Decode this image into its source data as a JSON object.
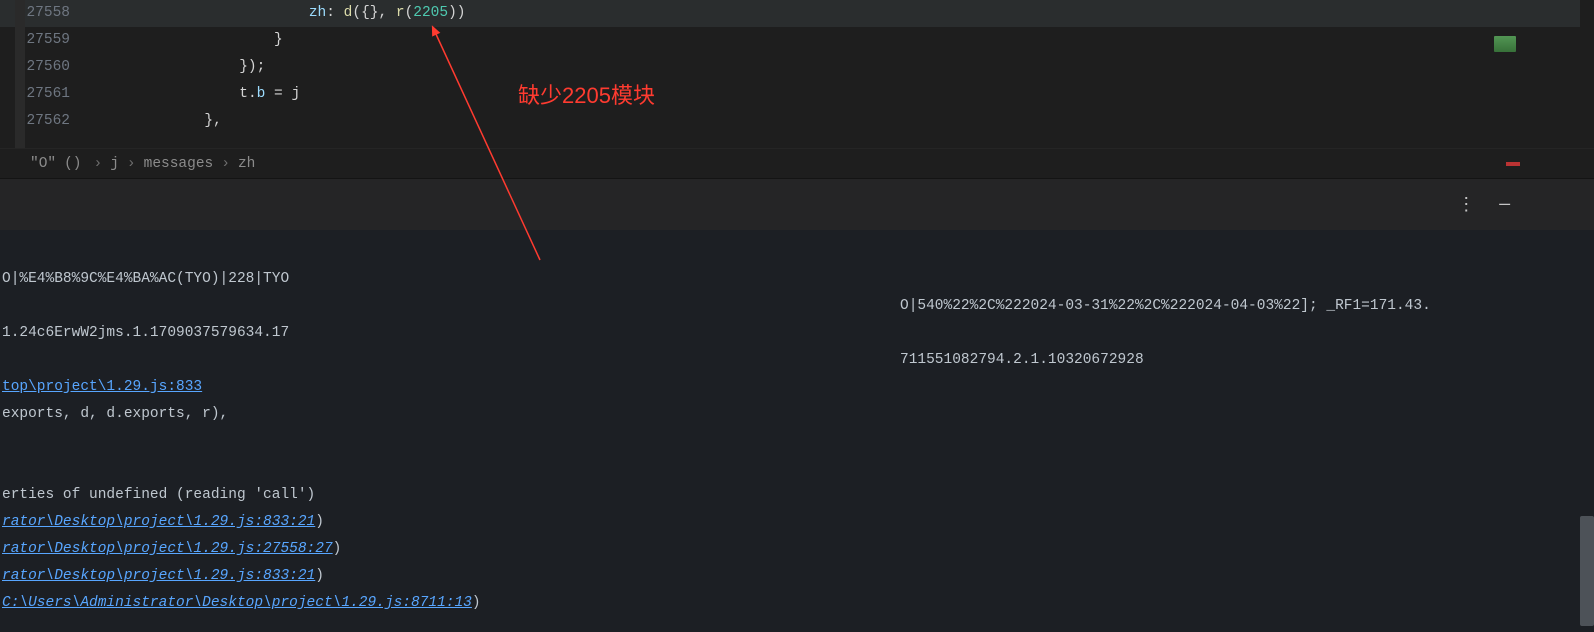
{
  "editor": {
    "lines": [
      {
        "num": "27558",
        "hl": true
      },
      {
        "num": "27559",
        "hl": false
      },
      {
        "num": "27560",
        "hl": false
      },
      {
        "num": "27561",
        "hl": false
      },
      {
        "num": "27562",
        "hl": false
      }
    ],
    "code": {
      "l0_prop": "zh",
      "l0_fn_d": "d",
      "l0_empty": "{}",
      "l0_fn_r": "r",
      "l0_num": "2205",
      "l1": "                    }",
      "l2": "                });",
      "l3_a": "t",
      "l3_b": "b",
      "l3_c": "j",
      "l4": "            },"
    },
    "annotation_text": "缺少2205模块"
  },
  "breadcrumb": {
    "seg_o": "\"O\"",
    "seg_paren": "()",
    "seg_j": "j",
    "seg_messages": "messages",
    "seg_zh": "zh",
    "sep": "›"
  },
  "terminal": {
    "left": {
      "l1": "O|%E4%B8%9C%E4%BA%AC(TYO)|228|TYO",
      "l2": "",
      "l3": "1.24c6ErwW2jms.1.1709037579634.17",
      "l4": "",
      "l5_link": "top\\project\\1.29.js:833",
      "l6": "exports, d, d.exports, r),",
      "l7": "",
      "l8": "",
      "l9": "erties of undefined (reading 'call')",
      "l10_link": "rator\\Desktop\\project\\1.29.js:833:21",
      "l10_tail": ")",
      "l11_link": "rator\\Desktop\\project\\1.29.js:27558:27",
      "l11_tail": ")",
      "l12_link": "rator\\Desktop\\project\\1.29.js:833:21",
      "l12_tail": ")",
      "l13_link": "C:\\Users\\Administrator\\Desktop\\project\\1.29.js:8711:13",
      "l13_tail": ")"
    },
    "right": {
      "r1": "O|540%22%2C%222024-03-31%22%2C%222024-04-03%22]; _RF1=171.43.",
      "r2": "",
      "r3": "711551082794.2.1.10320672928"
    }
  }
}
